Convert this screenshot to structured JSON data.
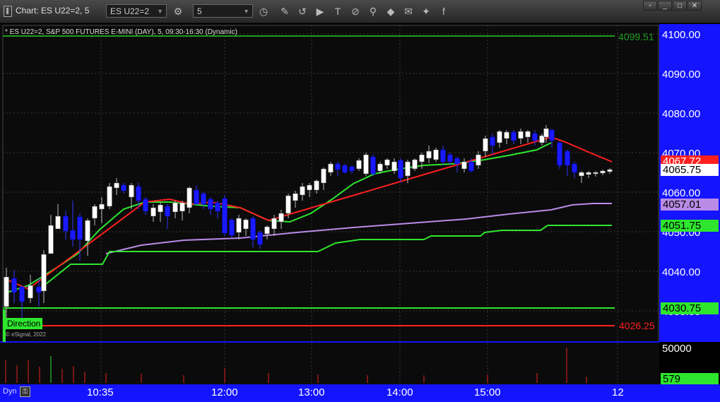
{
  "toolbar": {
    "title": "Chart: ES U22=2, 5",
    "symbol_value": "ES U22=2",
    "interval_value": "5",
    "icons": [
      "chart-window-icon",
      "settings-icon",
      "clock-icon",
      "pencil-icon",
      "draw-curve-icon",
      "play-icon",
      "text-icon",
      "eraser-icon",
      "link-icon",
      "note-icon",
      "twitter-icon",
      "facebook-icon"
    ],
    "window_buttons": [
      "pin-icon",
      "minimize-icon",
      "restore-icon",
      "close-icon"
    ]
  },
  "chart": {
    "legend": "* ES U22=2, S&P 500 FUTURES E-MINI (DAY), 5, 09:30-16:30 (Dynamic)",
    "direction_label": "Direction",
    "watermark": "© eSignal, 2022",
    "dyn_label": "Dyn",
    "colors": {
      "up_body": "#ffffff",
      "down_body": "#1a1aff",
      "bg": "#0b0b0b",
      "axis": "#1414ff",
      "green": "#2ee62e",
      "red": "#ff1f1f",
      "purple": "#b98be6"
    }
  },
  "price_axis": {
    "labels": [
      "4100.00",
      "4090.00",
      "4080.00",
      "4070.00",
      "4060.00",
      "4050.00",
      "4040.00",
      "4030.00"
    ],
    "volume_label": "50000"
  },
  "time_axis": {
    "labels": [
      "10:35",
      "12:00",
      "13:00",
      "14:00",
      "15:00",
      "12"
    ]
  },
  "price_tags": {
    "line_4099": "4099.51",
    "red_ma": "4067.72",
    "last": "4065.75",
    "purple": "4057.01",
    "green_step": "4051.75",
    "green_low": "4030.75",
    "red_low": "4026.25",
    "volume": "579"
  }
}
